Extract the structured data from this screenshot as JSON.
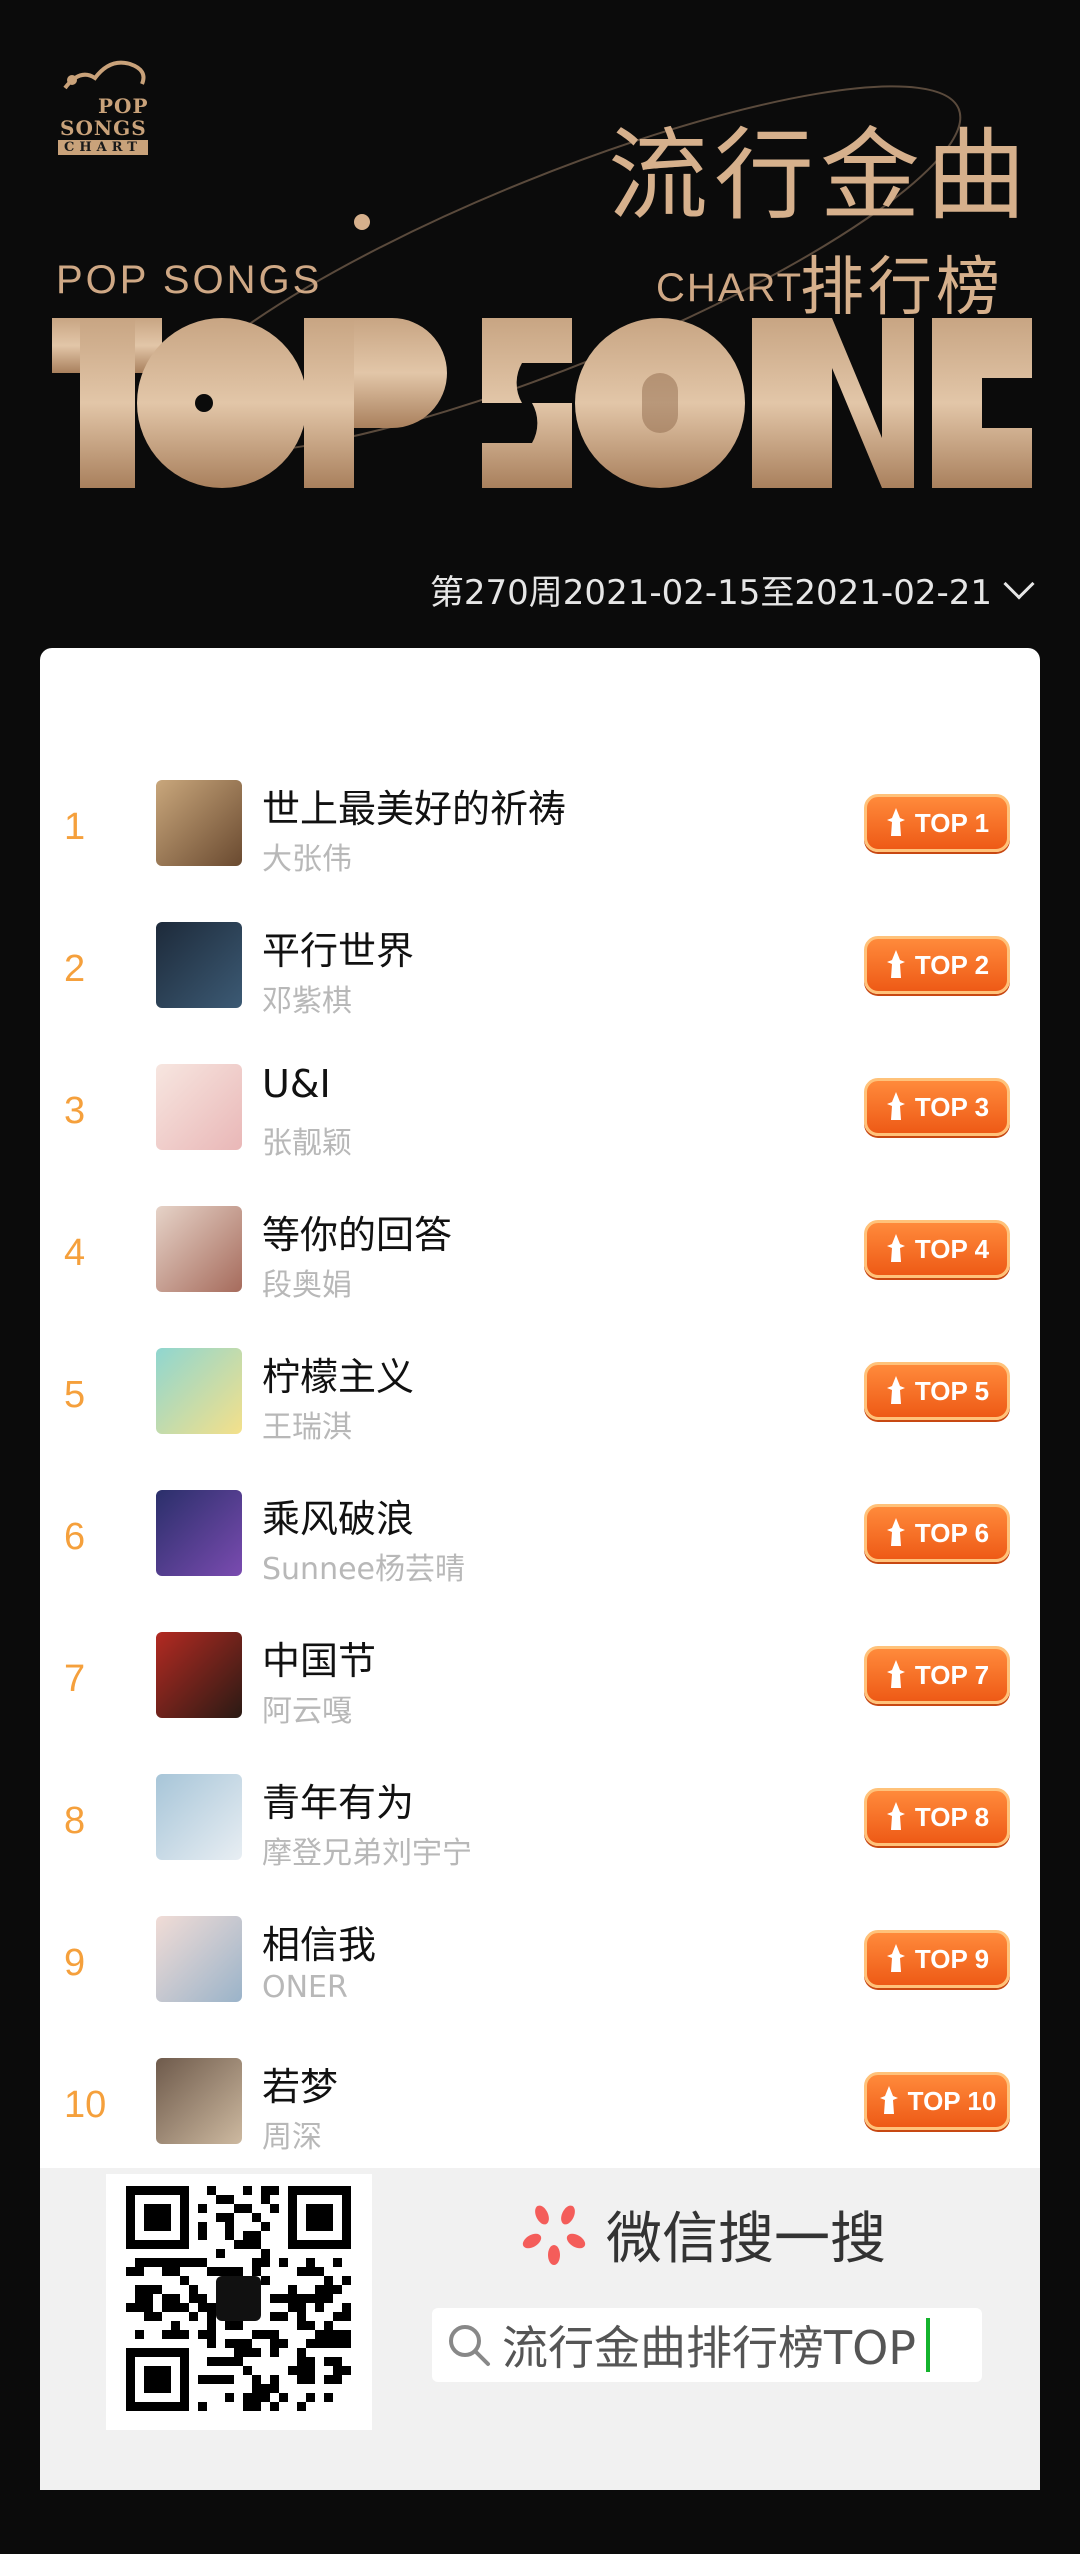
{
  "header": {
    "logo_line1": "POP",
    "logo_line2": "SONGS",
    "logo_line3": "CHART",
    "title_cn": "流行金曲",
    "subtitle_cn": "排行榜",
    "pop_songs": "POP SONGS",
    "chart_word": "CHART",
    "banner_text": "TOP SONGS"
  },
  "period": {
    "label": "第270周2021-02-15至2021-02-21"
  },
  "songs": [
    {
      "rank": "1",
      "title": "世上最美好的祈祷",
      "artist": "大张伟",
      "badge": "TOP 1"
    },
    {
      "rank": "2",
      "title": "平行世界",
      "artist": "邓紫棋",
      "badge": "TOP 2"
    },
    {
      "rank": "3",
      "title": "U&I",
      "artist": "张靓颖",
      "badge": "TOP 3"
    },
    {
      "rank": "4",
      "title": "等你的回答",
      "artist": "段奥娟",
      "badge": "TOP 4"
    },
    {
      "rank": "5",
      "title": "柠檬主义",
      "artist": "王瑞淇",
      "badge": "TOP 5"
    },
    {
      "rank": "6",
      "title": "乘风破浪",
      "artist": "Sunnee杨芸晴",
      "badge": "TOP 6"
    },
    {
      "rank": "7",
      "title": "中国节",
      "artist": "阿云嘎",
      "badge": "TOP 7"
    },
    {
      "rank": "8",
      "title": "青年有为",
      "artist": "摩登兄弟刘宇宁",
      "badge": "TOP 8"
    },
    {
      "rank": "9",
      "title": "相信我",
      "artist": "ONER",
      "badge": "TOP 9"
    },
    {
      "rank": "10",
      "title": "若梦",
      "artist": "周深",
      "badge": "TOP 10"
    }
  ],
  "footer": {
    "wechat_label": "微信搜一搜",
    "search_text": "流行金曲排行榜TOP"
  },
  "colors": {
    "accent_gold": "#d6b08c",
    "rank_orange": "#f5a03c",
    "badge_orange": "#ee5a16",
    "wechat_green": "#14b32d"
  }
}
